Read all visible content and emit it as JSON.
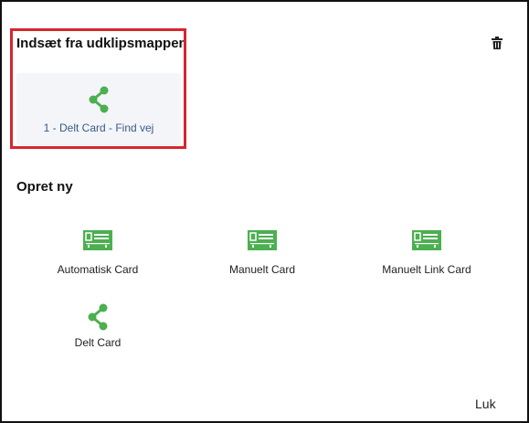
{
  "clipboard": {
    "title": "Indsæt fra udklipsmappen",
    "delete_icon": "trash-icon",
    "items": [
      {
        "label": "1 - Delt Card - Find vej",
        "icon": "share-icon"
      }
    ]
  },
  "create": {
    "title": "Opret ny",
    "options": [
      {
        "label": "Automatisk Card",
        "icon": "card-icon"
      },
      {
        "label": "Manuelt Card",
        "icon": "card-icon"
      },
      {
        "label": "Manuelt Link Card",
        "icon": "card-icon"
      },
      {
        "label": "Delt Card",
        "icon": "share-icon"
      }
    ]
  },
  "footer": {
    "close_label": "Luk"
  },
  "colors": {
    "accent_green": "#4caf50",
    "highlight_red": "#d6262f",
    "link_blue": "#3b5a85"
  }
}
